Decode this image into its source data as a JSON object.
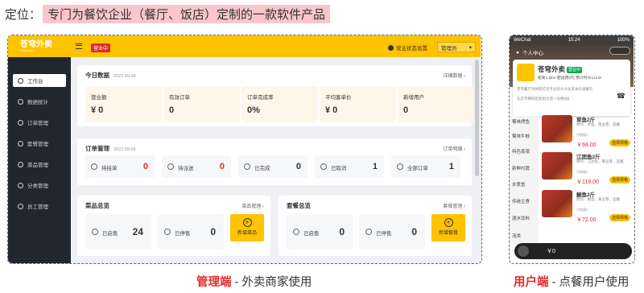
{
  "headline": {
    "prefix": "定位：",
    "highlight": "专门为餐饮企业（餐厅、饭店）定制的一款软件产品"
  },
  "admin": {
    "logo": "苍穹外卖",
    "logo_sub": "TAKE OUT",
    "status_badge": "营业中",
    "shop_status_label": "营业状态设置",
    "user_name": "管理员",
    "sidebar": [
      {
        "label": "工作台",
        "icon": "workbench-icon",
        "active": true
      },
      {
        "label": "数据统计",
        "icon": "stats-icon"
      },
      {
        "label": "订单管理",
        "icon": "order-icon"
      },
      {
        "label": "套餐管理",
        "icon": "setmeal-icon"
      },
      {
        "label": "菜品管理",
        "icon": "dish-icon"
      },
      {
        "label": "分类管理",
        "icon": "category-icon"
      },
      {
        "label": "员工管理",
        "icon": "employee-icon"
      }
    ],
    "today": {
      "title": "今日数据",
      "date": "2022.09.08",
      "link": "详细数据",
      "stats": [
        {
          "label": "营业额",
          "value": "¥ 0"
        },
        {
          "label": "有效订单",
          "value": "0"
        },
        {
          "label": "订单完成率",
          "value": "0%"
        },
        {
          "label": "平均客单价",
          "value": "¥ 0"
        },
        {
          "label": "新增用户",
          "value": "0"
        }
      ]
    },
    "orders": {
      "title": "订单管理",
      "date": "2022.09.08",
      "link": "订单明细",
      "items": [
        {
          "label": "待接单",
          "value": "0",
          "red": true
        },
        {
          "label": "待派送",
          "value": "0",
          "red": true
        },
        {
          "label": "已完成",
          "value": "0"
        },
        {
          "label": "已取消",
          "value": "1"
        },
        {
          "label": "全部订单",
          "value": "1"
        }
      ]
    },
    "dishes": {
      "title": "菜品总览",
      "link": "菜品管理",
      "items": [
        {
          "label": "已启售",
          "value": "24"
        },
        {
          "label": "已停售",
          "value": "0"
        }
      ],
      "add": "新增菜品"
    },
    "setmeals": {
      "title": "套餐总览",
      "link": "套餐管理",
      "items": [
        {
          "label": "已启售",
          "value": "0"
        },
        {
          "label": "已停售",
          "value": "0"
        }
      ],
      "add": "新增套餐"
    }
  },
  "phone": {
    "carrier": "WeChat",
    "time": "15:24",
    "battery": "100%",
    "nav_title": "个人中心",
    "shop_name": "苍穹外卖",
    "shop_badge": "营业中",
    "meta": "距离1.5km  配送费6元  预计时长12min",
    "desc": "苍穹餐厅为顾客打造专业的大众化美食外送餐饮",
    "address": "北京市朝阳区新街大道一号楼8层",
    "categories": [
      "蜀味烤鱼",
      "蜀味牛蛙",
      "特色蒸菜",
      "新鲜时蔬",
      "水煮鱼",
      "传统主食",
      "酒水饮料",
      "汤类"
    ],
    "dishes": [
      {
        "name": "草鱼2斤",
        "desc": "原料：草鱼，黄豆芽，莲藕",
        "stat": "月销量0",
        "price": "￥68.00",
        "btn": "选择规格"
      },
      {
        "name": "江团鱼2斤",
        "desc": "原料：江团鱼，黄豆芽，莲藕",
        "stat": "月销量0",
        "price": "￥119.00",
        "btn": "选择规格"
      },
      {
        "name": "鮰鱼2斤",
        "desc": "原料：鮰鱼，黄豆芽，莲藕",
        "stat": "月销量0",
        "price": "￥72.00",
        "btn": "选择规格"
      }
    ],
    "cart_total": "￥0"
  },
  "captions": {
    "admin_bold": "管理端",
    "admin_rest": " - 外卖商家使用",
    "user_bold": "用户端",
    "user_rest": " - 点餐用户使用"
  }
}
